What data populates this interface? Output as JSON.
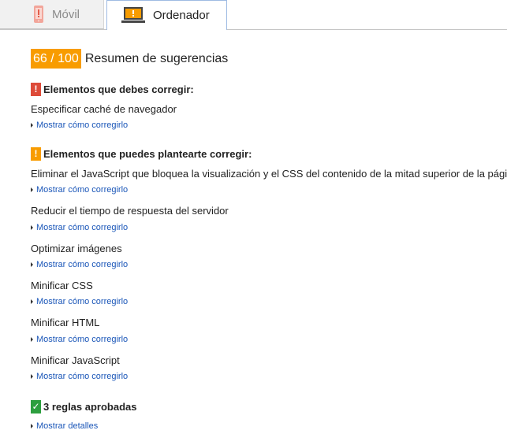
{
  "tabs": {
    "movil": "Móvil",
    "ordenador": "Ordenador"
  },
  "summary": {
    "score": "66 / 100",
    "title": "Resumen de sugerencias"
  },
  "must_fix": {
    "header": "Elementos que debes corregir:",
    "badge": "!",
    "rules": [
      {
        "title": "Especificar caché de navegador",
        "link": "Mostrar cómo corregirlo"
      }
    ]
  },
  "consider_fix": {
    "header": "Elementos que puedes plantearte corregir:",
    "badge": "!",
    "rules": [
      {
        "title": "Eliminar el JavaScript que bloquea la visualización y el CSS del contenido de la mitad superior de la página",
        "link": "Mostrar cómo corregirlo"
      },
      {
        "title": "Reducir el tiempo de respuesta del servidor",
        "link": "Mostrar cómo corregirlo"
      },
      {
        "title": "Optimizar imágenes",
        "link": "Mostrar cómo corregirlo"
      },
      {
        "title": "Minificar CSS",
        "link": "Mostrar cómo corregirlo"
      },
      {
        "title": "Minificar HTML",
        "link": "Mostrar cómo corregirlo"
      },
      {
        "title": "Minificar JavaScript",
        "link": "Mostrar cómo corregirlo"
      }
    ]
  },
  "passed": {
    "header": "3 reglas aprobadas",
    "badge": "✓",
    "link": "Mostrar detalles"
  },
  "icons": {
    "movil_tab": "phone-icon",
    "ordenador_tab": "monitor-icon",
    "link_arrow": "triangle-right-icon"
  },
  "colors": {
    "score_badge": "#f89c00",
    "must_fix": "#dd4b39",
    "consider_fix": "#f89c00",
    "passed": "#2d9f3f",
    "link": "#1a56b8"
  }
}
